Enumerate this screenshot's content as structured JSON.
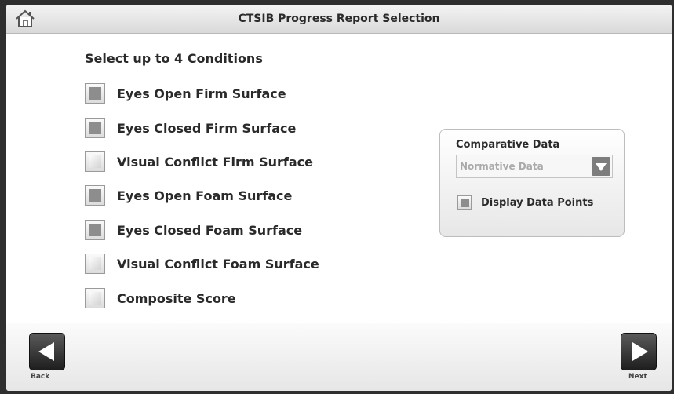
{
  "header": {
    "title": "CTSIB Progress Report Selection",
    "home_icon": "home-icon"
  },
  "conditions": {
    "heading": "Select up to 4 Conditions",
    "items": [
      {
        "label": "Eyes Open Firm Surface",
        "checked": true
      },
      {
        "label": "Eyes Closed Firm Surface",
        "checked": true
      },
      {
        "label": "Visual Conflict Firm Surface",
        "checked": false
      },
      {
        "label": "Eyes Open Foam Surface",
        "checked": true
      },
      {
        "label": "Eyes Closed Foam Surface",
        "checked": true
      },
      {
        "label": "Visual Conflict Foam Surface",
        "checked": false
      },
      {
        "label": "Composite Score",
        "checked": false
      }
    ]
  },
  "comparative": {
    "title": "Comparative Data",
    "select_value": "Normative Data",
    "display_points_label": "Display Data Points",
    "display_points_checked": true
  },
  "footer": {
    "back_label": "Back",
    "next_label": "Next"
  }
}
